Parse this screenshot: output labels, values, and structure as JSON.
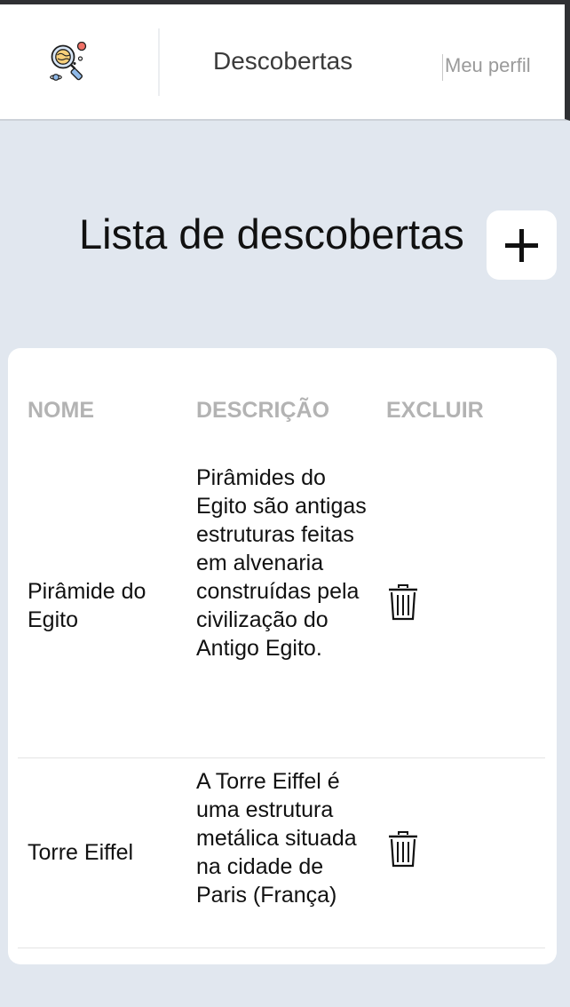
{
  "header": {
    "logo_icon": "magnifier-planet-logo-icon",
    "nav_title": "Descobertas",
    "profile_link": "Meu perfil"
  },
  "page": {
    "title": "Lista de descobertas",
    "add_icon": "plus-icon"
  },
  "table": {
    "columns": [
      "NOME",
      "DESCRIÇÃO",
      "EXCLUIR"
    ],
    "rows": [
      {
        "name": "Pirâmide do Egito",
        "description": "Pirâmides do Egito são antigas estruturas feitas em alvenaria construídas pela civilização do Antigo Egito.",
        "delete_icon": "trash-icon"
      },
      {
        "name": "Torre Eiffel",
        "description": "A Torre Eiffel é uma estrutura metálica situada na cidade de Paris (França)",
        "delete_icon": "trash-icon"
      }
    ]
  },
  "colors": {
    "background": "#e1e7ef",
    "card": "#ffffff",
    "header_text": "#b3b3b3",
    "body_text": "#111111"
  }
}
